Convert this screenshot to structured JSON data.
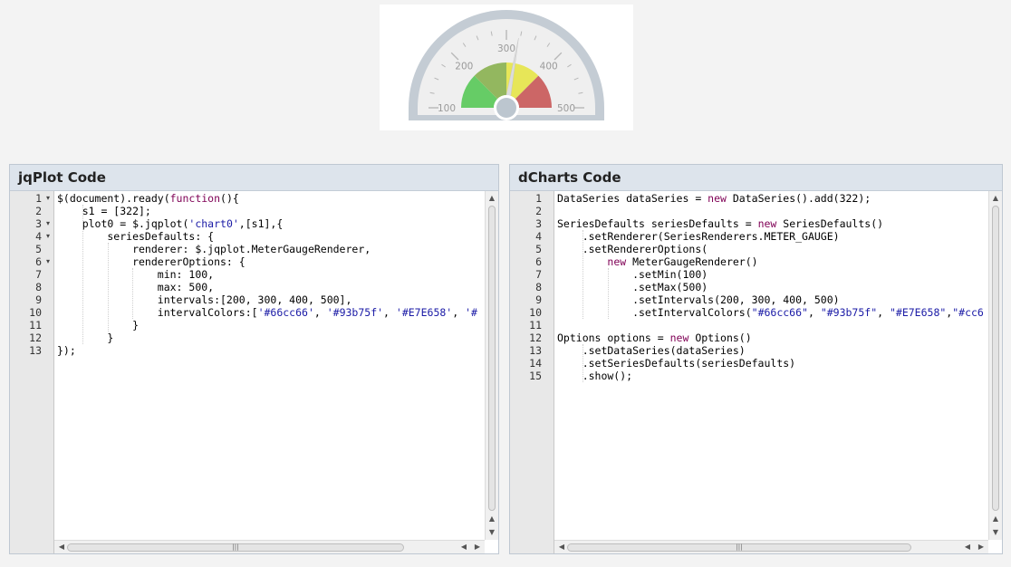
{
  "gauge": {
    "value": 322,
    "min": 100,
    "max": 500,
    "ticks": [
      "100",
      "200",
      "300",
      "400",
      "500"
    ],
    "interval_colors": [
      "#66cc66",
      "#93b75f",
      "#E7E658",
      "#cc6666"
    ],
    "intervals": [
      200,
      300,
      400,
      500
    ]
  },
  "left_panel": {
    "title": "jqPlot Code",
    "lines": [
      "$(document).ready(function(){",
      "    s1 = [322];",
      "    plot0 = $.jqplot('chart0',[s1],{",
      "        seriesDefaults: {",
      "            renderer: $.jqplot.MeterGaugeRenderer,",
      "            rendererOptions: {",
      "                min: 100,",
      "                max: 500,",
      "                intervals:[200, 300, 400, 500],",
      "                intervalColors:['#66cc66', '#93b75f', '#E7E658', '#",
      "            }",
      "        }",
      "});"
    ],
    "fold_lines": [
      1,
      3,
      4,
      6
    ]
  },
  "right_panel": {
    "title": "dCharts Code",
    "lines": [
      "DataSeries dataSeries = new DataSeries().add(322);",
      "",
      "SeriesDefaults seriesDefaults = new SeriesDefaults()",
      "    .setRenderer(SeriesRenderers.METER_GAUGE)",
      "    .setRendererOptions(",
      "        new MeterGaugeRenderer()",
      "            .setMin(100)",
      "            .setMax(500)",
      "            .setIntervals(200, 300, 400, 500)",
      "            .setIntervalColors(\"#66cc66\", \"#93b75f\", \"#E7E658\",\"#cc6",
      "",
      "Options options = new Options()",
      "    .setDataSeries(dataSeries)",
      "    .setSeriesDefaults(seriesDefaults)",
      "    .show();"
    ]
  },
  "icons": {
    "fold": "fold-arrow-icon",
    "scroll_up": "scroll-up-icon",
    "scroll_down": "scroll-down-icon",
    "scroll_left": "scroll-left-icon",
    "scroll_right": "scroll-right-icon",
    "grip": "scroll-grip-icon"
  }
}
